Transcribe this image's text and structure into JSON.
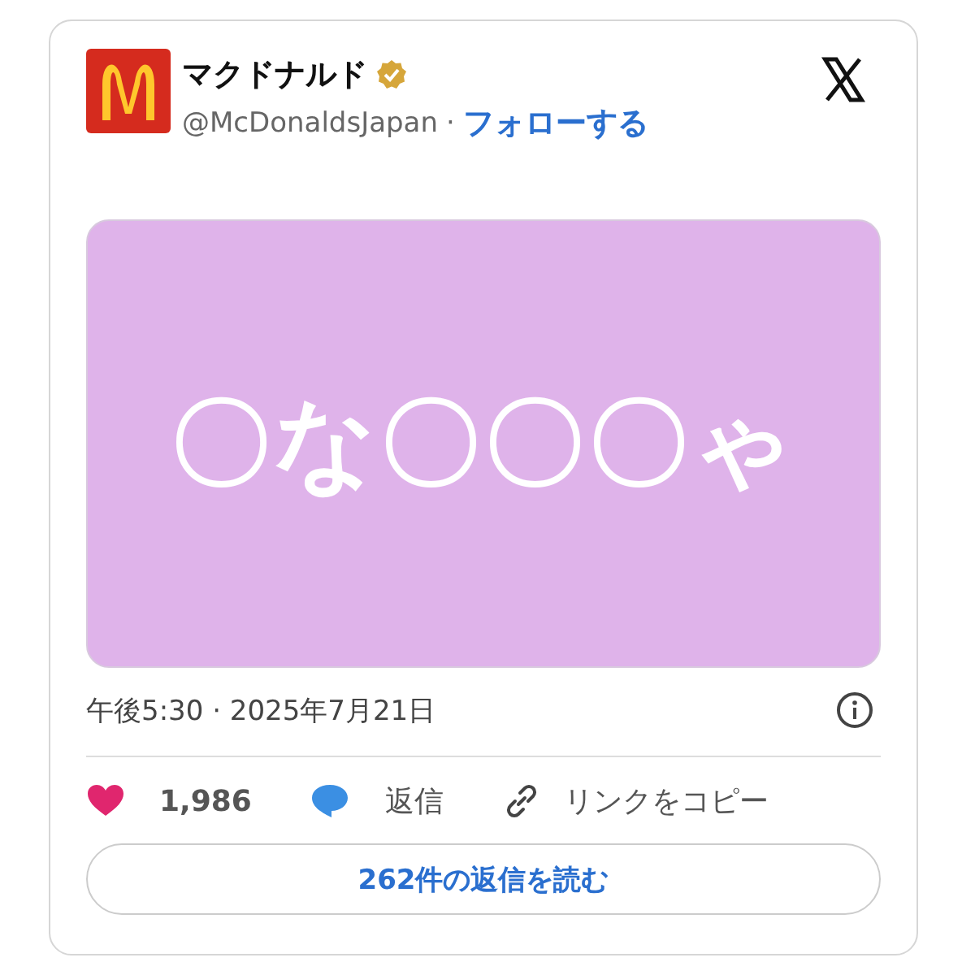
{
  "author": {
    "name": "マクドナルド",
    "verified": true,
    "handle": "@McDonaldsJapan",
    "separator": "·",
    "follow": "フォローする"
  },
  "media": {
    "text": "〇な〇〇〇ゃ"
  },
  "timestamp": "午後5:30 · 2025年7月21日",
  "actions": [
    {
      "kind": "like",
      "label": "1,986"
    },
    {
      "kind": "reply",
      "label": "返信"
    },
    {
      "kind": "link",
      "label": "リンクをコピー"
    }
  ],
  "read_replies": "262件の返信を読む"
}
